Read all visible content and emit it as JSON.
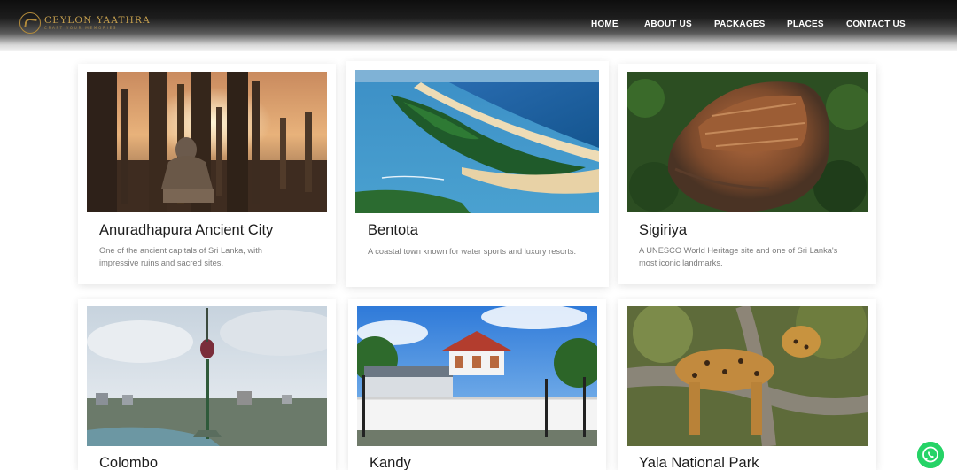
{
  "brand": {
    "name": "CEYLON YAATHRA",
    "tagline": "CRAFT YOUR MEMORIES",
    "accent_color": "#c9a24f"
  },
  "nav": {
    "items": [
      "HOME",
      "ABOUT US",
      "PACKAGES",
      "PLACES",
      "CONTACT US"
    ]
  },
  "places": [
    {
      "title": "Anuradhapura Ancient City",
      "description": "One of the ancient capitals of Sri Lanka, with impressive ruins and sacred sites.",
      "image": "ancient-ruins-buddha-statue-photo"
    },
    {
      "title": "Bentota",
      "description": "A coastal town known for water sports and luxury resorts.",
      "image": "coastal-beach-aerial-photo"
    },
    {
      "title": "Sigiriya",
      "description": "A UNESCO World Heritage site and one of Sri Lanka's most iconic landmarks.",
      "image": "rock-fortress-aerial-photo"
    },
    {
      "title": "Colombo",
      "description": "",
      "image": "city-skyline-lotus-tower-photo"
    },
    {
      "title": "Kandy",
      "description": "",
      "image": "temple-of-the-tooth-photo"
    },
    {
      "title": "Yala National Park",
      "description": "",
      "image": "leopard-on-tree-photo"
    }
  ],
  "floating": {
    "whatsapp_icon": "whatsapp-icon",
    "whatsapp_color": "#25d366"
  }
}
